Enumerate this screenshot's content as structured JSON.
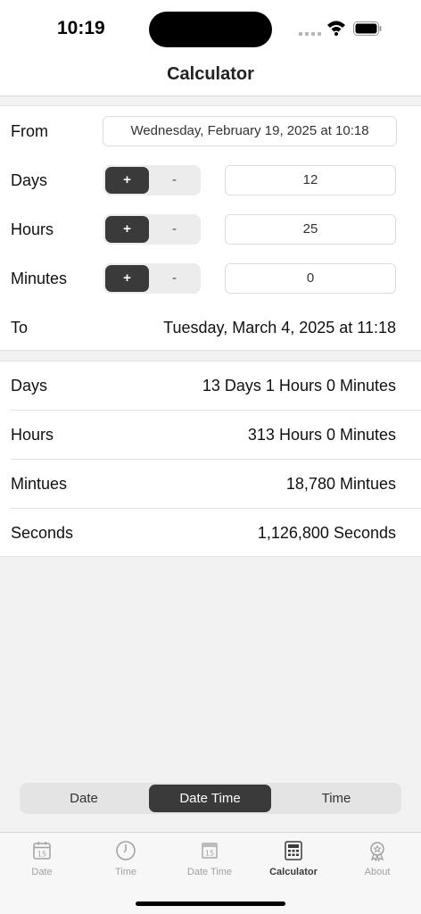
{
  "status": {
    "time": "10:19"
  },
  "nav": {
    "title": "Calculator"
  },
  "form": {
    "from": {
      "label": "From",
      "value": "Wednesday, February 19, 2025 at 10:18"
    },
    "days": {
      "label": "Days",
      "plus": "+",
      "minus": "-",
      "value": "12"
    },
    "hours": {
      "label": "Hours",
      "plus": "+",
      "minus": "-",
      "value": "25"
    },
    "minutes": {
      "label": "Minutes",
      "plus": "+",
      "minus": "-",
      "value": "0"
    },
    "to": {
      "label": "To",
      "value": "Tuesday, March 4, 2025 at 11:18"
    }
  },
  "results": [
    {
      "label": "Days",
      "value": "13 Days 1 Hours 0 Minutes"
    },
    {
      "label": "Hours",
      "value": "313 Hours 0 Minutes"
    },
    {
      "label": "Mintues",
      "value": "18,780 Mintues"
    },
    {
      "label": "Seconds",
      "value": "1,126,800 Seconds"
    }
  ],
  "mode": {
    "items": [
      "Date",
      "Date Time",
      "Time"
    ],
    "selected": "Date Time"
  },
  "tabbar": {
    "items": [
      {
        "label": "Date",
        "icon": "calendar-icon"
      },
      {
        "label": "Time",
        "icon": "clock-icon"
      },
      {
        "label": "Date Time",
        "icon": "calendar-clock-icon"
      },
      {
        "label": "Calculator",
        "icon": "calculator-icon"
      },
      {
        "label": "About",
        "icon": "badge-icon"
      }
    ],
    "selected": "Calculator",
    "calendar_day": "15"
  },
  "colors": {
    "accent": "#3a3a3a",
    "inactive": "#a0a0a0",
    "background": "#f2f2f2"
  }
}
